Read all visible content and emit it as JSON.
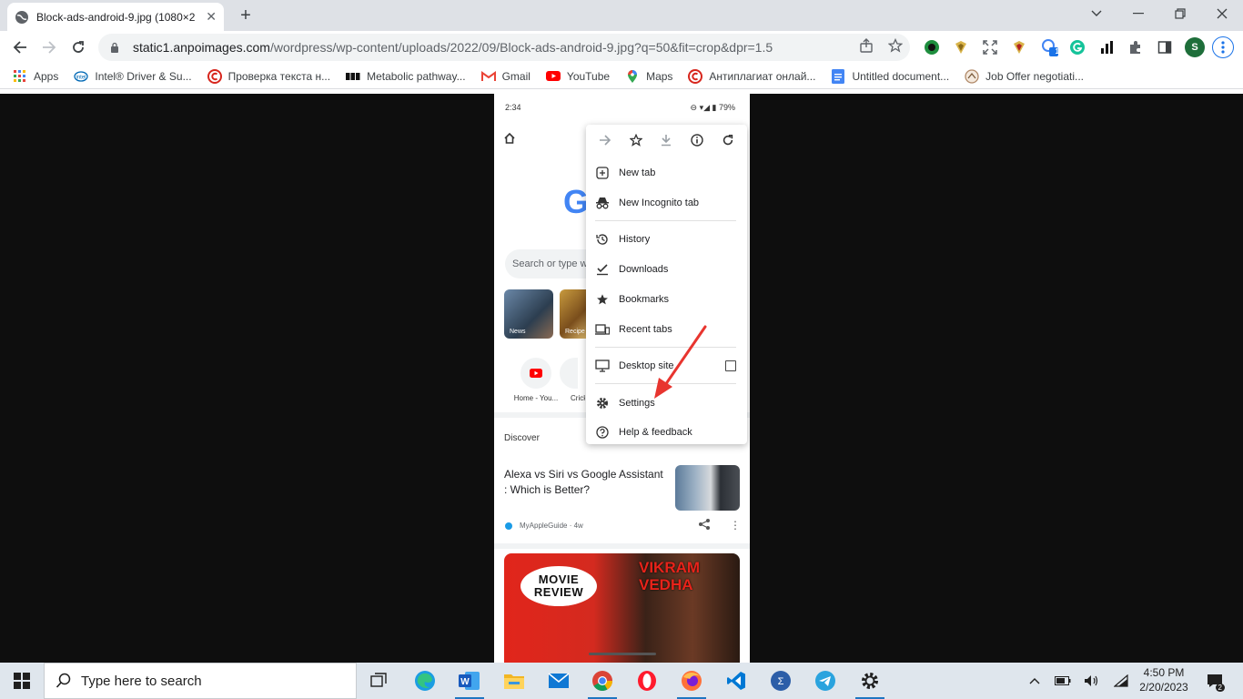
{
  "browser": {
    "tab_title": "Block-ads-android-9.jpg (1080×2",
    "new_tab": "+",
    "url_host": "static1.anpoimages.com",
    "url_path": "/wordpress/wp-content/uploads/2022/09/Block-ads-android-9.jpg?q=50&fit=crop&dpr=1.5",
    "profile_initial": "S",
    "extension_badge": "1"
  },
  "bookmarks": [
    {
      "label": "Apps",
      "icon": "apps-grid-icon"
    },
    {
      "label": "Intel® Driver & Su...",
      "icon": "intel-icon"
    },
    {
      "label": "Проверка текста н...",
      "icon": "copyright-red-icon"
    },
    {
      "label": "Metabolic pathway...",
      "icon": "bbc-icon"
    },
    {
      "label": "Gmail",
      "icon": "gmail-icon"
    },
    {
      "label": "YouTube",
      "icon": "youtube-icon"
    },
    {
      "label": "Maps",
      "icon": "maps-pin-icon"
    },
    {
      "label": "Антиплагиат онлай...",
      "icon": "copyright-red-icon"
    },
    {
      "label": "Untitled document...",
      "icon": "docs-icon"
    },
    {
      "label": "Job Offer negotiati...",
      "icon": "job-icon"
    }
  ],
  "phone": {
    "status_time": "2:34",
    "status_battery": "79%",
    "search_placeholder": "Search or type w",
    "thumbs": [
      {
        "label": "News"
      },
      {
        "label": "Recipe"
      }
    ],
    "shortcuts": [
      {
        "label": "Home - You..."
      },
      {
        "label": "Crick"
      }
    ],
    "discover": "Discover",
    "article_title": "Alexa vs Siri vs Google Assistant : Which is Better?",
    "article_source": "MyAppleGuide · 4w",
    "movie_bubble": [
      "MOVIE",
      "REVIEW"
    ],
    "movie_title": [
      "VIKRAM",
      "VEDHA"
    ]
  },
  "menu": {
    "top_icons": [
      "forward-arrow-icon",
      "star-icon",
      "download-icon",
      "info-icon",
      "refresh-icon"
    ],
    "items": [
      {
        "label": "New tab",
        "icon": "plus-box-icon"
      },
      {
        "label": "New Incognito tab",
        "icon": "incognito-icon"
      },
      {
        "label": "History",
        "icon": "history-icon"
      },
      {
        "label": "Downloads",
        "icon": "downloads-check-icon"
      },
      {
        "label": "Bookmarks",
        "icon": "star-filled-icon"
      },
      {
        "label": "Recent tabs",
        "icon": "devices-icon"
      },
      {
        "label": "Desktop site",
        "icon": "monitor-icon",
        "checked": false
      },
      {
        "label": "Settings",
        "icon": "gear-icon"
      },
      {
        "label": "Help & feedback",
        "icon": "help-icon"
      }
    ],
    "arrow_color": "#e8352f"
  },
  "taskbar": {
    "search_placeholder": "Type here to search",
    "time": "4:50 PM",
    "date": "2/20/2023",
    "notification_count": "2",
    "apps": [
      "task-view",
      "edge",
      "word",
      "file-explorer",
      "mail",
      "chrome",
      "opera",
      "firefox",
      "vscode",
      "calculator-app",
      "telegram",
      "settings"
    ]
  }
}
